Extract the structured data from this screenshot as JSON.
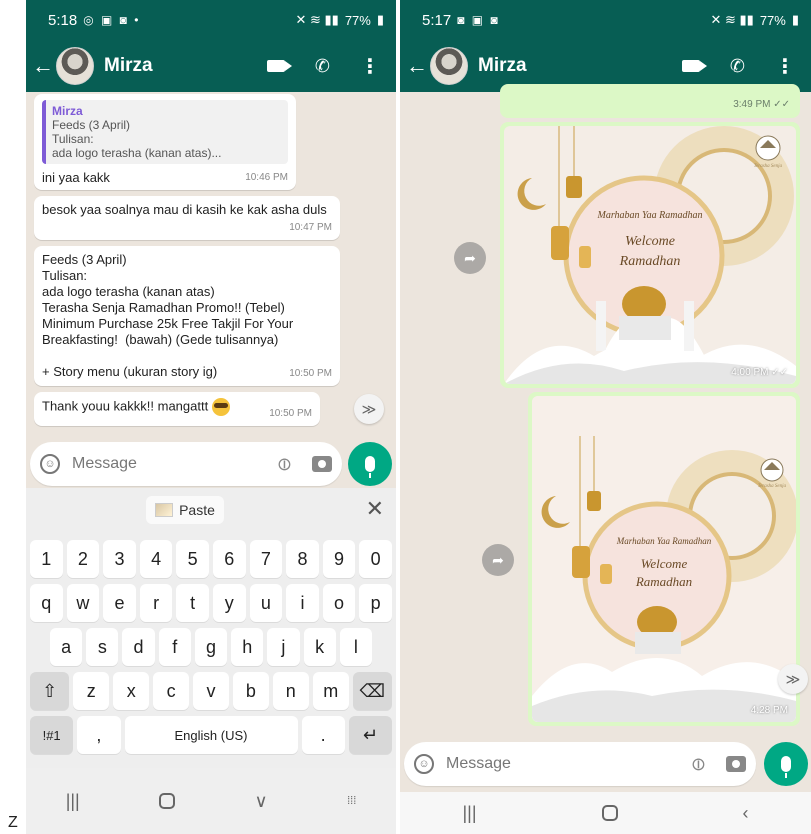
{
  "left": {
    "status": {
      "time": "5:18",
      "battery": "77%"
    },
    "header": {
      "contact_name": "Mirza"
    },
    "messages": {
      "quote_name": "Mirza",
      "quote_text": "Feeds (3 April)\nTulisan:\nada logo terasha (kanan atas)...",
      "m1_text": "ini yaa kakk",
      "m1_time": "10:46 PM",
      "m2_text": "besok yaa soalnya mau di kasih ke kak asha duls",
      "m2_time": "10:47 PM",
      "m3_text": "Feeds (3 April)\nTulisan:\nada logo terasha (kanan atas)\nTerasha Senja Ramadhan Promo!! (Tebel)\nMinimum Purchase 25k Free Takjil For Your Breakfasting!  (bawah) (Gede tulisannya)\n\n+ Story menu (ukuran story ig)",
      "m3_time": "10:50 PM",
      "m4_text": "Thank youu kakkk!! mangattt",
      "m4_time": "10:50 PM"
    },
    "input": {
      "placeholder": "Message"
    },
    "keyboard": {
      "paste_label": "Paste",
      "numbers": [
        "1",
        "2",
        "3",
        "4",
        "5",
        "6",
        "7",
        "8",
        "9",
        "0"
      ],
      "row1": [
        "q",
        "w",
        "e",
        "r",
        "t",
        "y",
        "u",
        "i",
        "o",
        "p"
      ],
      "row2": [
        "a",
        "s",
        "d",
        "f",
        "g",
        "h",
        "j",
        "k",
        "l"
      ],
      "row3": [
        "z",
        "x",
        "c",
        "v",
        "b",
        "n",
        "m"
      ],
      "sym_label": "!#1",
      "comma_label": ",",
      "space_label": "English (US)",
      "period_label": "."
    }
  },
  "right": {
    "status": {
      "time": "5:17",
      "battery": "77%"
    },
    "header": {
      "contact_name": "Mirza"
    },
    "t0": "3:49 PM",
    "img1_time": "4:00 PM",
    "img2_time": "4:28 PM",
    "poster": {
      "line1": "Marhaban Yaa Ramadhan",
      "line2": "Welcome",
      "line3": "Ramadhan",
      "brand": "Terasha Senja"
    },
    "input": {
      "placeholder": "Message"
    }
  },
  "stray_char": "Z"
}
